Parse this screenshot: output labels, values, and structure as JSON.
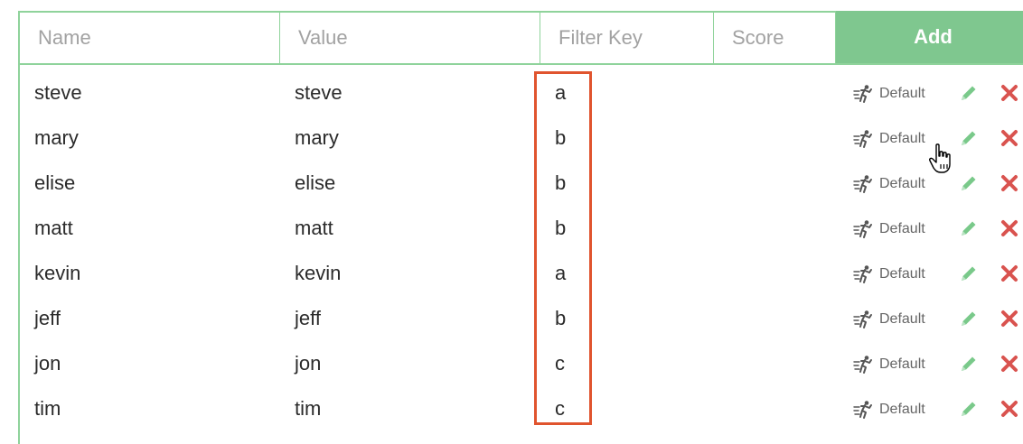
{
  "header": {
    "name_placeholder": "Name",
    "value_placeholder": "Value",
    "filter_key_placeholder": "Filter Key",
    "score_placeholder": "Score",
    "add_label": "Add"
  },
  "rows": [
    {
      "name": "steve",
      "value": "steve",
      "filter_key": "a",
      "mode": "Default"
    },
    {
      "name": "mary",
      "value": "mary",
      "filter_key": "b",
      "mode": "Default"
    },
    {
      "name": "elise",
      "value": "elise",
      "filter_key": "b",
      "mode": "Default"
    },
    {
      "name": "matt",
      "value": "matt",
      "filter_key": "b",
      "mode": "Default"
    },
    {
      "name": "kevin",
      "value": "kevin",
      "filter_key": "a",
      "mode": "Default"
    },
    {
      "name": "jeff",
      "value": "jeff",
      "filter_key": "b",
      "mode": "Default"
    },
    {
      "name": "jon",
      "value": "jon",
      "filter_key": "c",
      "mode": "Default"
    },
    {
      "name": "tim",
      "value": "tim",
      "filter_key": "c",
      "mode": "Default"
    }
  ],
  "icons": {
    "mode": "running-person-icon",
    "edit": "pencil-icon",
    "delete": "close-icon",
    "cursor": "hand-pointer-icon"
  },
  "colors": {
    "border_accent": "#8fd39b",
    "add_button": "#7fc78f",
    "edit_icon": "#79c98a",
    "delete_icon": "#d9534f",
    "highlight": "#e0542e"
  }
}
